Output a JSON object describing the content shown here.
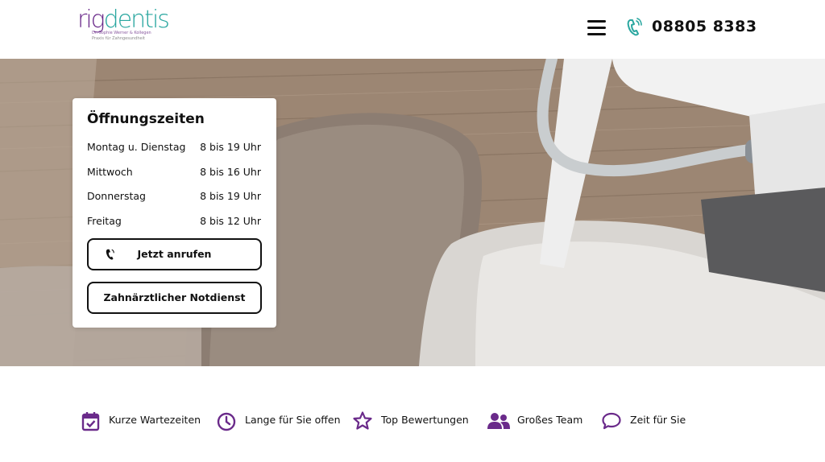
{
  "brand": {
    "logo_part1": "rig",
    "logo_part2": "dentis",
    "logo_tagline": "Dr. Sophie Werner & Kollegen",
    "logo_tagline2": "Praxis für Zahngesundheit"
  },
  "header": {
    "phone": "08805 8383",
    "menu_icon": "hamburger-icon",
    "phone_icon": "phone-icon"
  },
  "hours_card": {
    "title": "Öffnungszeiten",
    "rows": [
      {
        "day": "Montag u. Dienstag",
        "time": "8 bis 19 Uhr"
      },
      {
        "day": "Mittwoch",
        "time": "8 bis 16 Uhr"
      },
      {
        "day": "Donnerstag",
        "time": "8 bis 19 Uhr"
      },
      {
        "day": "Freitag",
        "time": "8 bis 12 Uhr"
      }
    ],
    "call_button": "Jetzt anrufen",
    "emergency_button": "Zahnärztlicher Notdienst"
  },
  "features": [
    {
      "icon": "calendar-check-icon",
      "label": "Kurze Wartezeiten"
    },
    {
      "icon": "clock-icon",
      "label": "Lange für Sie offen"
    },
    {
      "icon": "star-icon",
      "label": "Top Bewertungen"
    },
    {
      "icon": "users-icon",
      "label": "Großes Team"
    },
    {
      "icon": "chat-bubble-icon",
      "label": "Zeit für Sie"
    }
  ],
  "colors": {
    "accent_purple": "#6a2a8a",
    "accent_teal": "#2aa7a0",
    "text": "#111111"
  }
}
